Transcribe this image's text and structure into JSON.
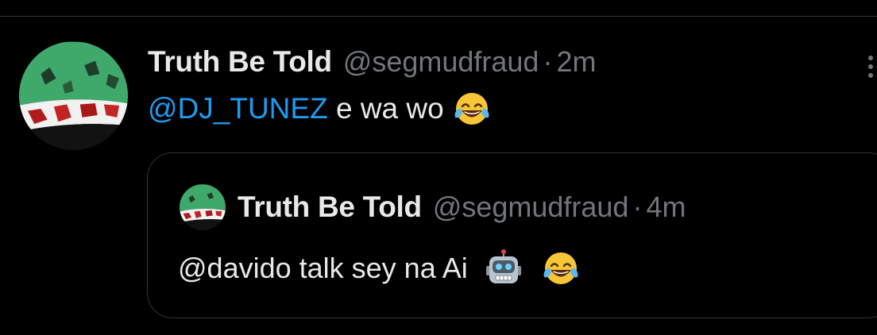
{
  "tweet": {
    "author": {
      "display_name": "Truth Be Told",
      "handle": "@segmudfraud",
      "avatar_icon": "profile-avatar"
    },
    "separator": "·",
    "timestamp": "2m",
    "text": {
      "mention": "@DJ_TUNEZ",
      "body": " e wa wo ",
      "emoji": "face-with-tears-of-joy-icon"
    },
    "more_icon": "more-options-icon"
  },
  "quoted_tweet": {
    "author": {
      "display_name": "Truth Be Told",
      "handle": "@segmudfraud",
      "avatar_icon": "profile-avatar"
    },
    "separator": "·",
    "timestamp": "4m",
    "text": {
      "body": "@davido talk sey na Ai ",
      "emojis": [
        "robot-face-icon",
        "face-with-tears-of-joy-icon"
      ]
    }
  },
  "colors": {
    "background": "#000000",
    "primary_text": "#e7e9ea",
    "secondary_text": "#71767b",
    "link": "#1d9bf0",
    "border": "#2f3336"
  }
}
